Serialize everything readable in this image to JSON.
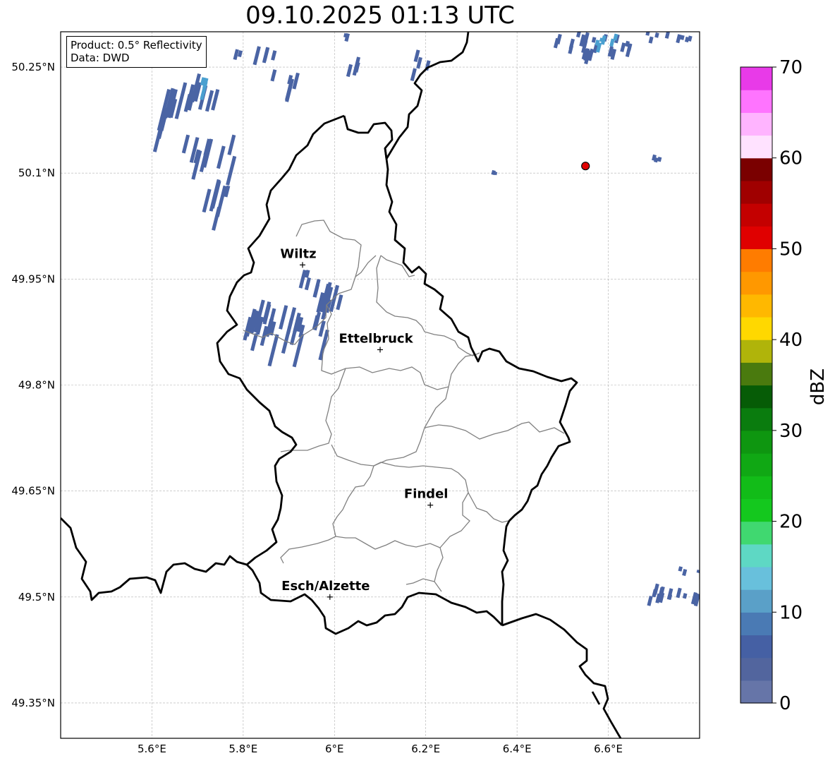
{
  "title": "09.10.2025 01:13 UTC",
  "info": {
    "product": "Product: 0.5° Reflectivity",
    "data_source": "Data: DWD"
  },
  "map": {
    "lon_range": [
      5.4,
      6.8
    ],
    "lat_range": [
      49.3,
      50.3
    ],
    "lon_ticks": [
      {
        "value": 5.6,
        "label": "5.6°E"
      },
      {
        "value": 5.8,
        "label": "5.8°E"
      },
      {
        "value": 6.0,
        "label": "6°E"
      },
      {
        "value": 6.2,
        "label": "6.2°E"
      },
      {
        "value": 6.4,
        "label": "6.4°E"
      },
      {
        "value": 6.6,
        "label": "6.6°E"
      }
    ],
    "lat_ticks": [
      {
        "value": 50.25,
        "label": "50.25°N"
      },
      {
        "value": 50.1,
        "label": "50.1°N"
      },
      {
        "value": 49.95,
        "label": "49.95°N"
      },
      {
        "value": 49.8,
        "label": "49.8°N"
      },
      {
        "value": 49.65,
        "label": "49.65°N"
      },
      {
        "value": 49.5,
        "label": "49.5°N"
      },
      {
        "value": 49.35,
        "label": "49.35°N"
      }
    ],
    "cities": [
      {
        "name": "Wiltz",
        "lon": 5.93,
        "lat": 49.97
      },
      {
        "name": "Ettelbruck",
        "lon": 6.1,
        "lat": 49.85
      },
      {
        "name": "Findel",
        "lon": 6.21,
        "lat": 49.63
      },
      {
        "name": "Esch/Alzette",
        "lon": 5.99,
        "lat": 49.5
      }
    ],
    "radar_site": {
      "lon": 6.55,
      "lat": 50.11,
      "color": "#e00000"
    },
    "colors": {
      "country_border": "#000000",
      "district_border": "#808080",
      "grid": "#b0b0b0",
      "echo": "#4a64a4",
      "echo_light": "#4aa0d0"
    }
  },
  "colorbar": {
    "label": "dBZ",
    "min": 0,
    "max": 70,
    "ticks": [
      0,
      10,
      20,
      30,
      40,
      50,
      60,
      70
    ],
    "tick_labels": [
      "0",
      "10",
      "20",
      "30",
      "40",
      "50",
      "60",
      "70"
    ],
    "levels": [
      "#6675a8",
      "#52659e",
      "#4560a4",
      "#4a7ab4",
      "#5aa0c8",
      "#68c0dc",
      "#5ed8c4",
      "#40d870",
      "#14c81e",
      "#12bc18",
      "#10a814",
      "#0e9610",
      "#0a7c0e",
      "#065c06",
      "#4a7a0e",
      "#b0b40a",
      "#ffd800",
      "#ffb800",
      "#ff9800",
      "#ff7c00",
      "#e00000",
      "#c40000",
      "#a00000",
      "#7a0000",
      "#ffe2ff",
      "#ffb4ff",
      "#ff74ff",
      "#e83ae8"
    ]
  },
  "chart_data": {
    "type": "heatmap",
    "title": "09.10.2025 01:13 UTC",
    "xlabel": "",
    "ylabel": "",
    "xlim": [
      5.4,
      6.8
    ],
    "ylim": [
      49.3,
      50.3
    ],
    "x_ticks": [
      "5.6°E",
      "5.8°E",
      "6°E",
      "6.2°E",
      "6.4°E",
      "6.6°E"
    ],
    "y_ticks": [
      "50.25°N",
      "50.1°N",
      "49.95°N",
      "49.8°N",
      "49.65°N",
      "49.5°N",
      "49.35°N"
    ],
    "colorbar_label": "dBZ",
    "colorbar_range": [
      0,
      70
    ],
    "echo_clusters": [
      {
        "lon": 5.67,
        "lat": 50.21,
        "dbz": 6
      },
      {
        "lon": 5.74,
        "lat": 50.15,
        "dbz": 5
      },
      {
        "lon": 5.78,
        "lat": 50.08,
        "dbz": 4
      },
      {
        "lon": 5.9,
        "lat": 50.25,
        "dbz": 4
      },
      {
        "lon": 5.97,
        "lat": 50.24,
        "dbz": 4
      },
      {
        "lon": 6.06,
        "lat": 50.26,
        "dbz": 4
      },
      {
        "lon": 6.19,
        "lat": 50.26,
        "dbz": 5
      },
      {
        "lon": 6.58,
        "lat": 50.29,
        "dbz": 7
      },
      {
        "lon": 6.72,
        "lat": 50.3,
        "dbz": 4
      },
      {
        "lon": 6.35,
        "lat": 50.1,
        "dbz": 4
      },
      {
        "lon": 6.71,
        "lat": 50.12,
        "dbz": 4
      },
      {
        "lon": 5.93,
        "lat": 49.96,
        "dbz": 4
      },
      {
        "lon": 5.93,
        "lat": 49.9,
        "dbz": 6
      },
      {
        "lon": 6.74,
        "lat": 49.51,
        "dbz": 6
      }
    ]
  }
}
